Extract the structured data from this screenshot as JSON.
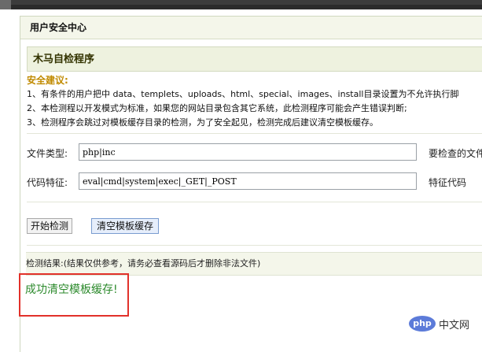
{
  "header": {
    "title": "用户安全中心"
  },
  "section": {
    "title": "木马自检程序"
  },
  "advice": {
    "title": "安全建议:",
    "lines": [
      "1、有条件的用户把中 data、templets、uploads、html、special、images、install目录设置为不允许执行脚",
      "2、本检测程以开发模式为标准，如果您的网站目录包含其它系统，此检测程序可能会产生错误判断;",
      "3、检测程序会跳过对模板缓存目录的检测，为了安全起见，检测完成后建议清空模板缓存。"
    ]
  },
  "form": {
    "file_type": {
      "label": "文件类型:",
      "value": "php|inc",
      "hint": "要检查的文件"
    },
    "code_feature": {
      "label": "代码特征:",
      "value": "eval|cmd|system|exec|_GET|_POST",
      "hint": "特征代码"
    }
  },
  "buttons": {
    "start": "开始检测",
    "clear_cache": "清空模板缓存"
  },
  "result": {
    "label": "检测结果:(结果仅供参考，请务必查看源码后才删除非法文件)",
    "message": "成功清空模板缓存!"
  },
  "watermark": {
    "logo": "php",
    "text": "中文网"
  },
  "colors": {
    "success": "#2c8a2c",
    "highlight_box": "#e2312a",
    "advice_title": "#c08a00"
  }
}
